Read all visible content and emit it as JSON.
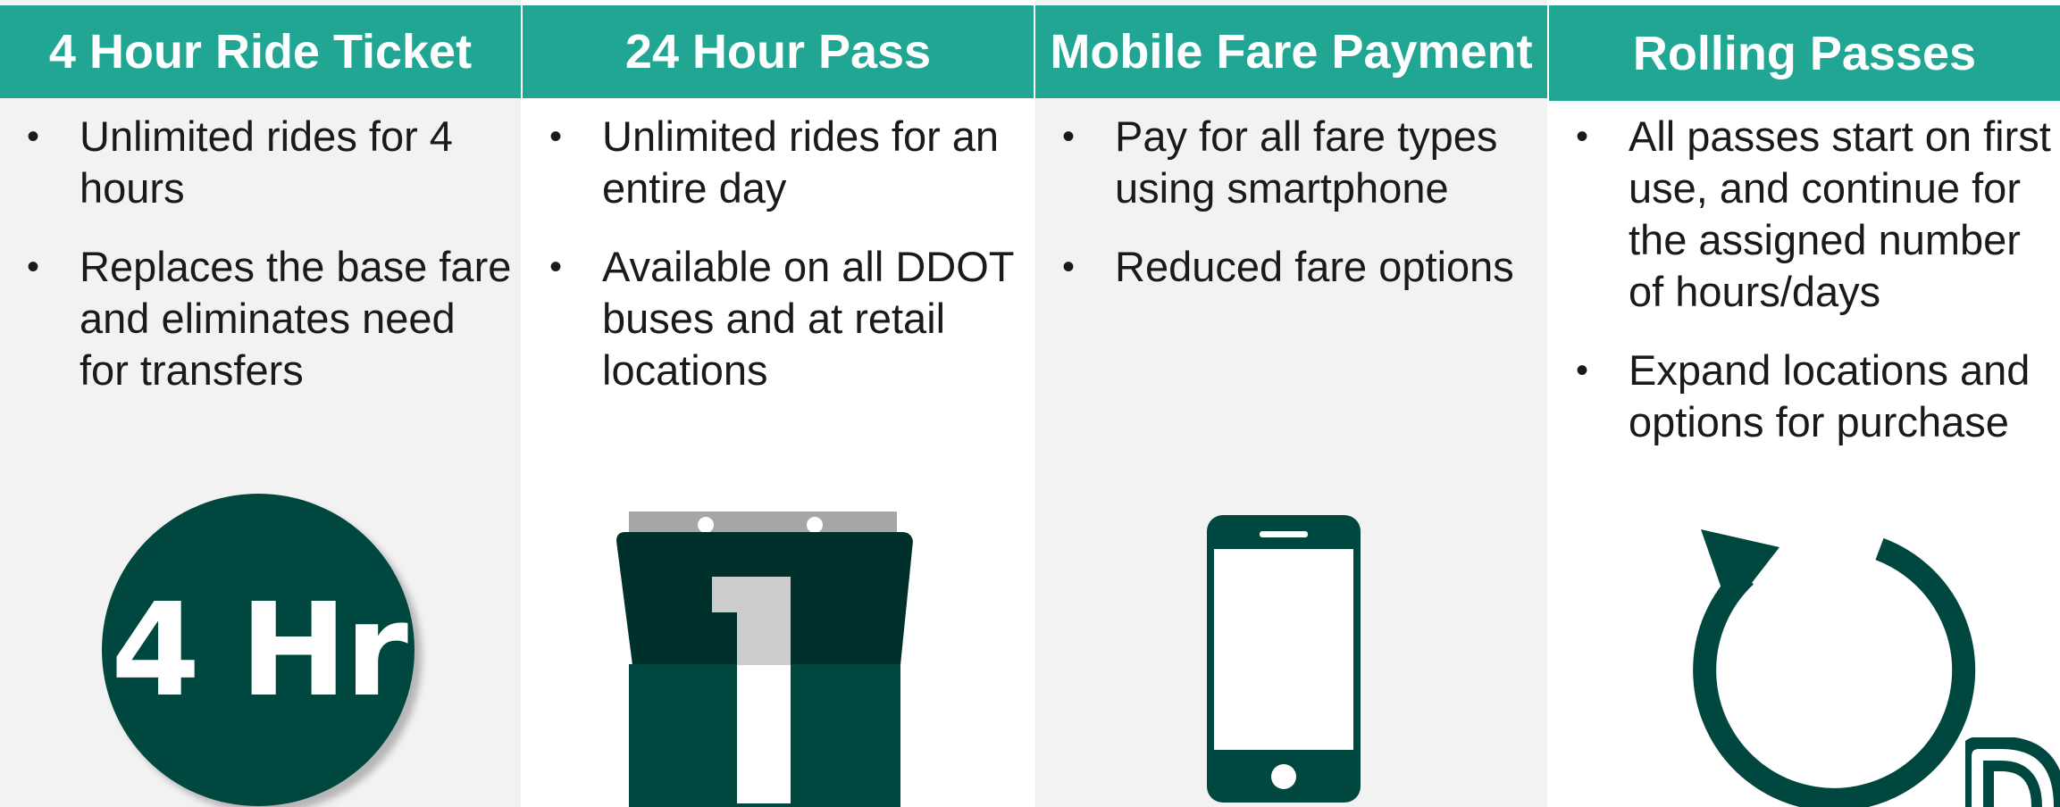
{
  "columns": [
    {
      "title": "4 Hour Ride Ticket",
      "bullets": [
        "Unlimited rides for 4 hours",
        "Replaces the base fare and eliminates need for transfers"
      ],
      "icon": "clock-badge-icon",
      "icon_text": "4 Hr"
    },
    {
      "title": "24 Hour Pass",
      "bullets": [
        "Unlimited rides for an entire day",
        "Available on all DDOT buses and at retail locations"
      ],
      "icon": "calendar-icon"
    },
    {
      "title": "Mobile Fare Payment",
      "bullets": [
        "Pay for all fare types using smartphone",
        "Reduced fare options"
      ],
      "icon": "smartphone-icon"
    },
    {
      "title": "Rolling Passes",
      "bullets": [
        "All passes start on first use, and continue for the assigned number of hours/days",
        "Expand locations and options for purchase"
      ],
      "icon": "refresh-arrow-icon"
    }
  ],
  "colors": {
    "header": "#22a694",
    "icon_dark": "#00473f",
    "panel_gray": "#f2f2f2"
  },
  "logo": "ddot-logo-icon"
}
